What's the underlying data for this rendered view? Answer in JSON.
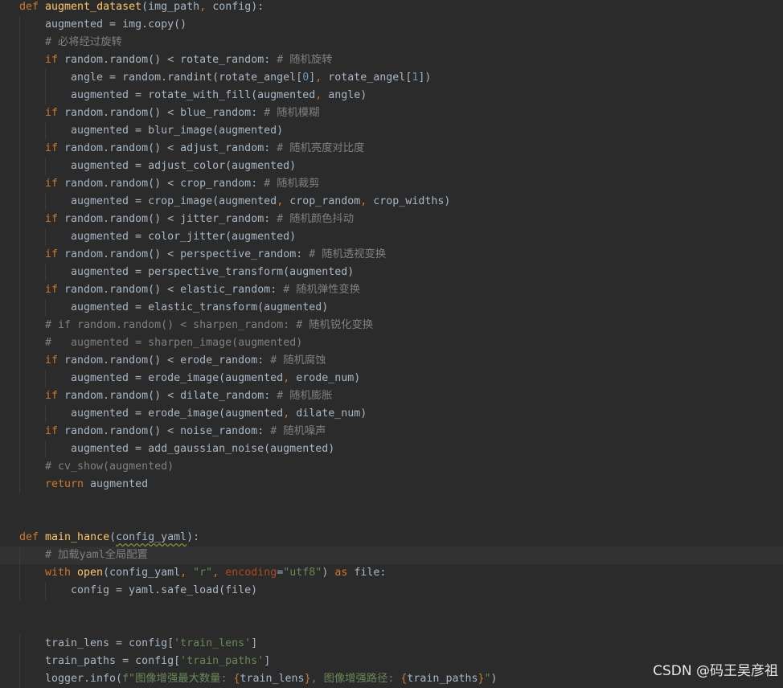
{
  "editor": {
    "lines": [
      {
        "indent": 0,
        "tokens": [
          [
            "def ",
            "kw"
          ],
          [
            "augment_dataset",
            "fn"
          ],
          [
            "(img_path",
            ""
          ],
          [
            ", ",
            "kw"
          ],
          [
            "config):",
            ""
          ]
        ]
      },
      {
        "indent": 1,
        "tokens": [
          [
            "augmented = img.copy()",
            ""
          ]
        ]
      },
      {
        "indent": 1,
        "tokens": [
          [
            "# 必将经过旋转",
            "cm"
          ]
        ]
      },
      {
        "indent": 1,
        "tokens": [
          [
            "if ",
            "kw"
          ],
          [
            "random.random() < rotate_random: ",
            ""
          ],
          [
            "# 随机旋转",
            "cm"
          ]
        ]
      },
      {
        "indent": 2,
        "tokens": [
          [
            "angle = random.randint(rotate_angel[",
            ""
          ],
          [
            "0",
            "num"
          ],
          [
            "]",
            ""
          ],
          [
            ", ",
            "kw"
          ],
          [
            "rotate_angel[",
            ""
          ],
          [
            "1",
            "num"
          ],
          [
            "])",
            ""
          ]
        ]
      },
      {
        "indent": 2,
        "tokens": [
          [
            "augmented = rotate_with_fill(augmented",
            ""
          ],
          [
            ", ",
            "kw"
          ],
          [
            "angle)",
            ""
          ]
        ]
      },
      {
        "indent": 1,
        "tokens": [
          [
            "if ",
            "kw"
          ],
          [
            "random.random() < blue_random: ",
            ""
          ],
          [
            "# 随机模糊",
            "cm"
          ]
        ]
      },
      {
        "indent": 2,
        "tokens": [
          [
            "augmented = blur_image(augmented)",
            ""
          ]
        ]
      },
      {
        "indent": 1,
        "tokens": [
          [
            "if ",
            "kw"
          ],
          [
            "random.random() < adjust_random: ",
            ""
          ],
          [
            "# 随机亮度对比度",
            "cm"
          ]
        ]
      },
      {
        "indent": 2,
        "tokens": [
          [
            "augmented = adjust_color(augmented)",
            ""
          ]
        ]
      },
      {
        "indent": 1,
        "tokens": [
          [
            "if ",
            "kw"
          ],
          [
            "random.random() < crop_random: ",
            ""
          ],
          [
            "# 随机裁剪",
            "cm"
          ]
        ]
      },
      {
        "indent": 2,
        "tokens": [
          [
            "augmented = crop_image(augmented",
            ""
          ],
          [
            ", ",
            "kw"
          ],
          [
            "crop_random",
            ""
          ],
          [
            ", ",
            "kw"
          ],
          [
            "crop_widths)",
            ""
          ]
        ]
      },
      {
        "indent": 1,
        "tokens": [
          [
            "if ",
            "kw"
          ],
          [
            "random.random() < jitter_random: ",
            ""
          ],
          [
            "# 随机颜色抖动",
            "cm"
          ]
        ]
      },
      {
        "indent": 2,
        "tokens": [
          [
            "augmented = color_jitter(augmented)",
            ""
          ]
        ]
      },
      {
        "indent": 1,
        "tokens": [
          [
            "if ",
            "kw"
          ],
          [
            "random.random() < perspective_random: ",
            ""
          ],
          [
            "# 随机透视变换",
            "cm"
          ]
        ]
      },
      {
        "indent": 2,
        "tokens": [
          [
            "augmented = perspective_transform(augmented)",
            ""
          ]
        ]
      },
      {
        "indent": 1,
        "tokens": [
          [
            "if ",
            "kw"
          ],
          [
            "random.random() < elastic_random: ",
            ""
          ],
          [
            "# 随机弹性变换",
            "cm"
          ]
        ]
      },
      {
        "indent": 2,
        "tokens": [
          [
            "augmented = elastic_transform(augmented)",
            ""
          ]
        ]
      },
      {
        "indent": 1,
        "tokens": [
          [
            "# if random.random() < sharpen_random: # 随机锐化变换",
            "cm"
          ]
        ]
      },
      {
        "indent": 1,
        "tokens": [
          [
            "#   augmented = sharpen_image(augmented)",
            "cm"
          ]
        ]
      },
      {
        "indent": 1,
        "tokens": [
          [
            "if ",
            "kw"
          ],
          [
            "random.random() < erode_random: ",
            ""
          ],
          [
            "# 随机腐蚀",
            "cm"
          ]
        ]
      },
      {
        "indent": 2,
        "tokens": [
          [
            "augmented = erode_image(augmented",
            ""
          ],
          [
            ", ",
            "kw"
          ],
          [
            "erode_num)",
            ""
          ]
        ]
      },
      {
        "indent": 1,
        "tokens": [
          [
            "if ",
            "kw"
          ],
          [
            "random.random() < dilate_random: ",
            ""
          ],
          [
            "# 随机膨胀",
            "cm"
          ]
        ]
      },
      {
        "indent": 2,
        "tokens": [
          [
            "augmented = erode_image(augmented",
            ""
          ],
          [
            ", ",
            "kw"
          ],
          [
            "dilate_num)",
            ""
          ]
        ]
      },
      {
        "indent": 1,
        "tokens": [
          [
            "if ",
            "kw"
          ],
          [
            "random.random() < noise_random: ",
            ""
          ],
          [
            "# 随机噪声",
            "cm"
          ]
        ]
      },
      {
        "indent": 2,
        "tokens": [
          [
            "augmented = add_gaussian_noise(augmented)",
            ""
          ]
        ]
      },
      {
        "indent": 1,
        "tokens": [
          [
            "# cv_show(augmented)",
            "cm"
          ]
        ]
      },
      {
        "indent": 1,
        "tokens": [
          [
            "return ",
            "kw"
          ],
          [
            "augmented",
            ""
          ]
        ]
      },
      {
        "indent": 0,
        "tokens": []
      },
      {
        "indent": 0,
        "tokens": []
      },
      {
        "indent": 0,
        "tokens": [
          [
            "def ",
            "kw"
          ],
          [
            "main_hance",
            "fn"
          ],
          [
            "(",
            ""
          ],
          [
            "config_yaml",
            "warn"
          ],
          [
            "):",
            ""
          ]
        ]
      },
      {
        "indent": 1,
        "highlight": true,
        "tokens": [
          [
            "# 加载yaml全局配置",
            "cm"
          ]
        ]
      },
      {
        "indent": 1,
        "tokens": [
          [
            "with ",
            "kw"
          ],
          [
            "open",
            "fn"
          ],
          [
            "(config_yaml",
            ""
          ],
          [
            ", ",
            "kw"
          ],
          [
            "\"r\"",
            "str"
          ],
          [
            ", ",
            "kw"
          ],
          [
            "encoding",
            "kwa"
          ],
          [
            "=",
            ""
          ],
          [
            "\"utf8\"",
            "str"
          ],
          [
            ") ",
            ""
          ],
          [
            "as ",
            "kw"
          ],
          [
            "file:",
            ""
          ]
        ]
      },
      {
        "indent": 2,
        "tokens": [
          [
            "config = yaml.safe_load(file)",
            ""
          ]
        ]
      },
      {
        "indent": 0,
        "tokens": []
      },
      {
        "indent": 0,
        "tokens": []
      },
      {
        "indent": 1,
        "tokens": [
          [
            "train_lens = config[",
            ""
          ],
          [
            "'train_lens'",
            "str"
          ],
          [
            "]",
            ""
          ]
        ]
      },
      {
        "indent": 1,
        "tokens": [
          [
            "train_paths = config[",
            ""
          ],
          [
            "'train_paths'",
            "str"
          ],
          [
            "]",
            ""
          ]
        ]
      },
      {
        "indent": 1,
        "tokens": [
          [
            "logger.info(",
            ""
          ],
          [
            "f\"图像增强最大数量: ",
            "str"
          ],
          [
            "{",
            "kw"
          ],
          [
            "train_lens",
            ""
          ],
          [
            "}",
            "kw"
          ],
          [
            ", 图像增强路径: ",
            "str"
          ],
          [
            "{",
            "kw"
          ],
          [
            "train_paths",
            ""
          ],
          [
            "}",
            "kw"
          ],
          [
            "\"",
            "str"
          ],
          [
            ")",
            ""
          ]
        ]
      }
    ]
  },
  "watermark": "CSDN @码王吴彦祖"
}
